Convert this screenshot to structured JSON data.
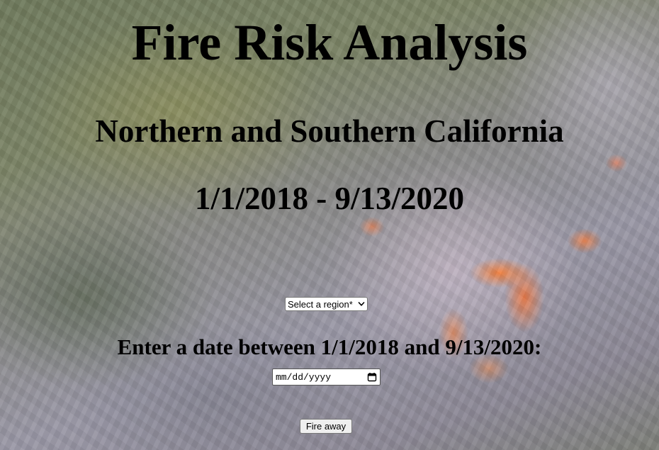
{
  "header": {
    "title": "Fire Risk Analysis",
    "subtitle": "Northern and Southern California",
    "date_range": "1/1/2018 - 9/13/2020"
  },
  "form": {
    "region_select": {
      "selected": "Select a region*",
      "icon": "chevron-down-icon"
    },
    "date_prompt": "Enter a date between 1/1/2018 and 9/13/2020:",
    "date_input": {
      "placeholder": "mm/dd/yyyy",
      "icon": "calendar-icon"
    },
    "submit_label": "Fire away"
  },
  "colors": {
    "fire_accent": "#ff7a2a",
    "text": "#000000"
  }
}
